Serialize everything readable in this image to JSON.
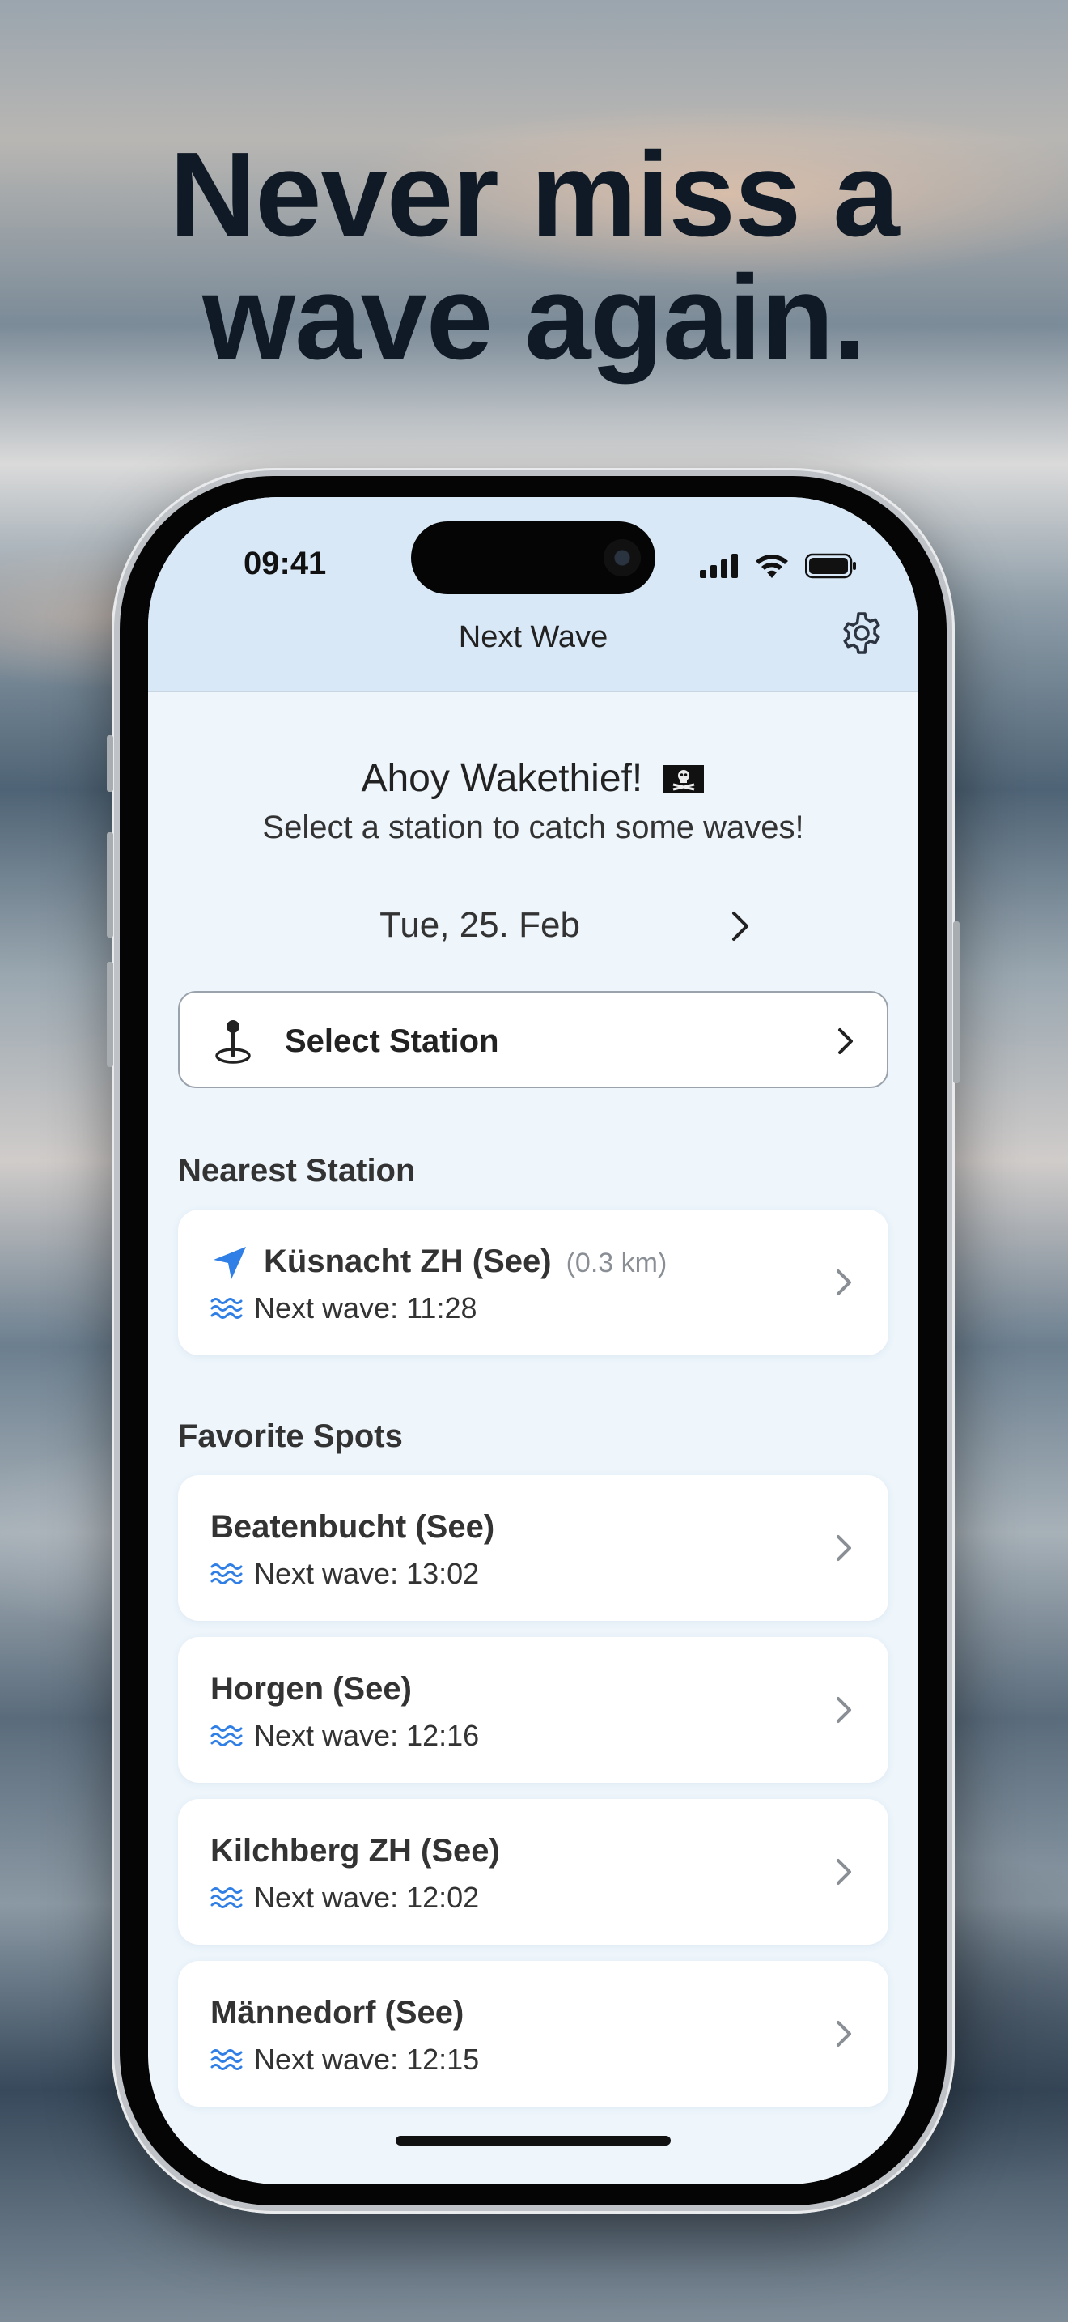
{
  "headline": {
    "line1": "Never miss a",
    "line2": "wave again."
  },
  "status_bar": {
    "time": "09:41",
    "icons": [
      "cellular-signal-icon",
      "wifi-icon",
      "battery-icon"
    ]
  },
  "nav": {
    "title": "Next Wave",
    "settings_icon": "gear-icon"
  },
  "greeting": {
    "title": "Ahoy Wakethief!",
    "flag_icon": "pirate-flag-icon",
    "subtitle": "Select a station to catch some waves!"
  },
  "date_selector": {
    "date": "Tue, 25. Feb",
    "next_icon": "chevron-right-icon"
  },
  "select_station": {
    "label": "Select Station",
    "icon": "map-pin-icon"
  },
  "nearest": {
    "heading": "Nearest Station",
    "station": {
      "name": "Küsnacht ZH (See)",
      "distance": "(0.3 km)",
      "next_wave": "Next wave: 11:28",
      "icon": "location-arrow-icon"
    }
  },
  "favorites": {
    "heading": "Favorite Spots",
    "items": [
      {
        "name": "Beatenbucht (See)",
        "next_wave": "Next wave: 13:02"
      },
      {
        "name": "Horgen (See)",
        "next_wave": "Next wave: 12:16"
      },
      {
        "name": "Kilchberg ZH (See)",
        "next_wave": "Next wave: 12:02"
      },
      {
        "name": "Männedorf (See)",
        "next_wave": "Next wave: 12:15"
      }
    ]
  },
  "colors": {
    "accent": "#2f7fe6",
    "nav_bg": "#d9e8f6",
    "screen_bg": "#eef6fc",
    "headline": "#0f1a26"
  }
}
